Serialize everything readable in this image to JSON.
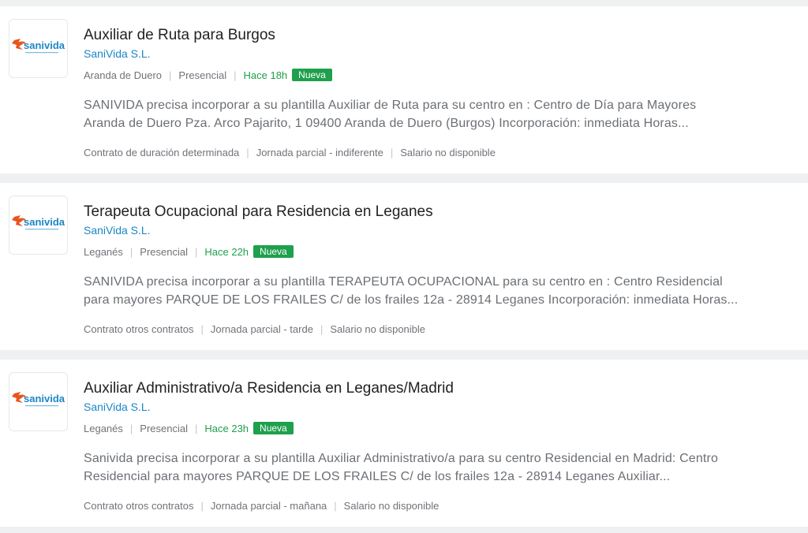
{
  "offers": [
    {
      "logo_icon": "sanivida-logo",
      "logo_text": "sanivida",
      "title": "Auxiliar de Ruta para Burgos",
      "company": "SaniVida S.L.",
      "location": "Aranda de Duero",
      "modality": "Presencial",
      "posted": "Hace 18h",
      "badge": "Nueva",
      "description_line1": "SANIVIDA precisa incorporar a su plantilla Auxiliar de Ruta para su centro en : Centro de Día para Mayores",
      "description_line2": "Aranda de Duero Pza. Arco Pajarito, 1 09400 Aranda de Duero (Burgos) Incorporación: inmediata Horas...",
      "contract": "Contrato de duración determinada",
      "schedule": "Jornada parcial - indiferente",
      "salary": "Salario no disponible"
    },
    {
      "logo_icon": "sanivida-logo",
      "logo_text": "sanivida",
      "title": "Terapeuta Ocupacional para Residencia en Leganes",
      "company": "SaniVida S.L.",
      "location": "Leganés",
      "modality": "Presencial",
      "posted": "Hace 22h",
      "badge": "Nueva",
      "description_line1": "SANIVIDA precisa incorporar a su plantilla TERAPEUTA OCUPACIONAL para su centro en : Centro Residencial",
      "description_line2": "para mayores PARQUE DE LOS FRAILES C/ de los frailes 12a - 28914 Leganes Incorporación: inmediata Horas...",
      "contract": "Contrato otros contratos",
      "schedule": "Jornada parcial - tarde",
      "salary": "Salario no disponible"
    },
    {
      "logo_icon": "sanivida-logo",
      "logo_text": "sanivida",
      "title": "Auxiliar Administrativo/a Residencia en Leganes/Madrid",
      "company": "SaniVida S.L.",
      "location": "Leganés",
      "modality": "Presencial",
      "posted": "Hace 23h",
      "badge": "Nueva",
      "description_line1": "Sanivida precisa incorporar a su plantilla Auxiliar Administrativo/a para su centro Residencial en Madrid: Centro",
      "description_line2": "Residencial para mayores PARQUE DE LOS FRAILES C/ de los frailes 12a - 28914 Leganes Auxiliar...",
      "contract": "Contrato otros contratos",
      "schedule": "Jornada parcial - mañana",
      "salary": "Salario no disponible"
    }
  ],
  "colors": {
    "title": "#222222",
    "company": "#1a86c8",
    "posted": "#1ea04c",
    "badge_bg": "#1ea04c",
    "muted": "#6f7378",
    "logo_orange": "#e8541e",
    "logo_blue": "#1f86c6"
  }
}
